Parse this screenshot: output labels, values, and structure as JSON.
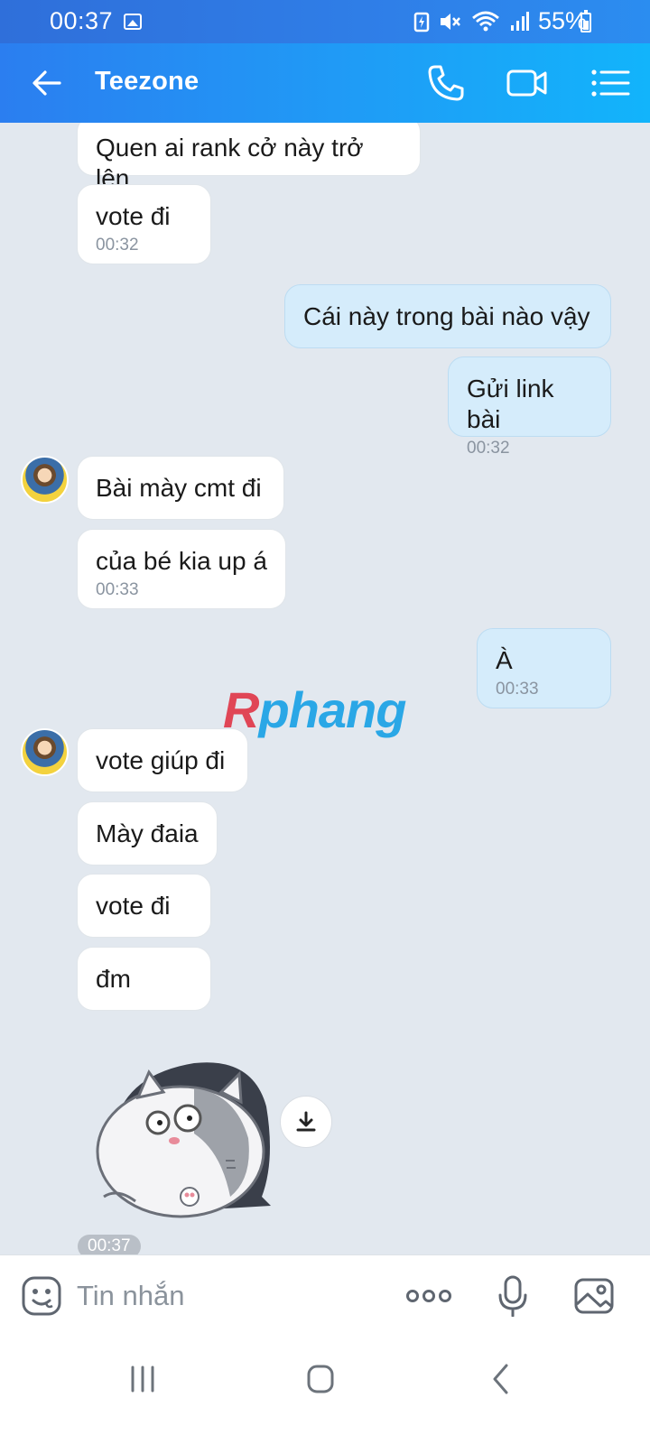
{
  "status_bar": {
    "time": "00:37",
    "battery_text": "55%",
    "battery_level_percent": 55
  },
  "header": {
    "title": "Teezone"
  },
  "messages": [
    {
      "direction": "in",
      "text": "Quen ai rank cở này trở lên",
      "time": ""
    },
    {
      "direction": "in",
      "text": "vote đi",
      "time": "00:32"
    },
    {
      "direction": "out",
      "text": "Cái này trong bài nào vậy",
      "time": ""
    },
    {
      "direction": "out",
      "text": "Gửi link bài",
      "time": "00:32"
    },
    {
      "direction": "in",
      "text": "Bài mày cmt đi",
      "time": ""
    },
    {
      "direction": "in",
      "text": "của bé kia up á",
      "time": "00:33"
    },
    {
      "direction": "out",
      "text": "À",
      "time": "00:33"
    },
    {
      "direction": "in",
      "text": "vote giúp đi",
      "time": ""
    },
    {
      "direction": "in",
      "text": "Mày đaia",
      "time": ""
    },
    {
      "direction": "in",
      "text": "vote đi",
      "time": ""
    },
    {
      "direction": "in",
      "text": "đm",
      "time": ""
    }
  ],
  "sticker": {
    "icon": "fat-cat-sticker",
    "time": "00:37"
  },
  "watermark": {
    "first_letter": "R",
    "rest": "phang"
  },
  "input": {
    "placeholder": "Tin nhắn"
  },
  "colors": {
    "header_gradient_start": "#2b7ef0",
    "header_gradient_end": "#12b4fb",
    "incoming_bubble": "#ffffff",
    "outgoing_bubble": "#d5ecfb",
    "chat_background": "#e2e8ef"
  }
}
